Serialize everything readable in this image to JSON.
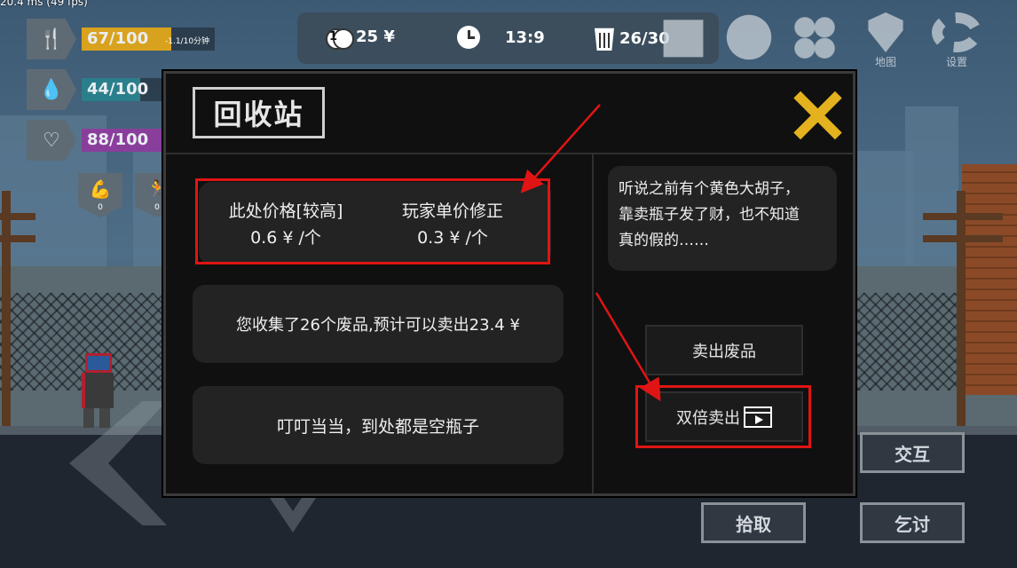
{
  "debug": {
    "fps_text": "20.4 ms (49 fps)"
  },
  "hud": {
    "money": "25 ¥",
    "coin_badge": "1",
    "time": "13:9",
    "trash": "26/30"
  },
  "menu": {
    "map_label": "地图",
    "settings_label": "设置"
  },
  "stats": {
    "hunger": {
      "text": "67/100",
      "sub": "-1.1/10分钟",
      "color": "#d9a21e",
      "fraction": 0.67
    },
    "water": {
      "text": "44/100",
      "color": "#2a7f8c",
      "fraction": 0.44
    },
    "health": {
      "text": "88/100",
      "color": "#8a3e9c",
      "fraction": 0.88
    },
    "buffs": [
      "0",
      "0"
    ]
  },
  "dialog": {
    "title": "回收站",
    "price_here_label": "此处价格[较高]",
    "price_here_value": "0.6 ¥ /个",
    "player_mod_label": "玩家单价修正",
    "player_mod_value": "0.3 ¥ /个",
    "collect_text": "您收集了26个废品,预计可以卖出23.4 ¥",
    "tip_text": "叮叮当当，到处都是空瓶子",
    "story_line1": "听说之前有个黄色大胡子，",
    "story_line2": "靠卖瓶子发了财，也不知道",
    "story_line3": "真的假的……",
    "sell_label": "卖出废品",
    "double_sell_label": "双倍卖出"
  },
  "actions": {
    "interact": "交互",
    "pickup": "拾取",
    "beg": "乞讨"
  },
  "colors": {
    "annotation": "#e01414",
    "close_x": "#e3b21e"
  }
}
